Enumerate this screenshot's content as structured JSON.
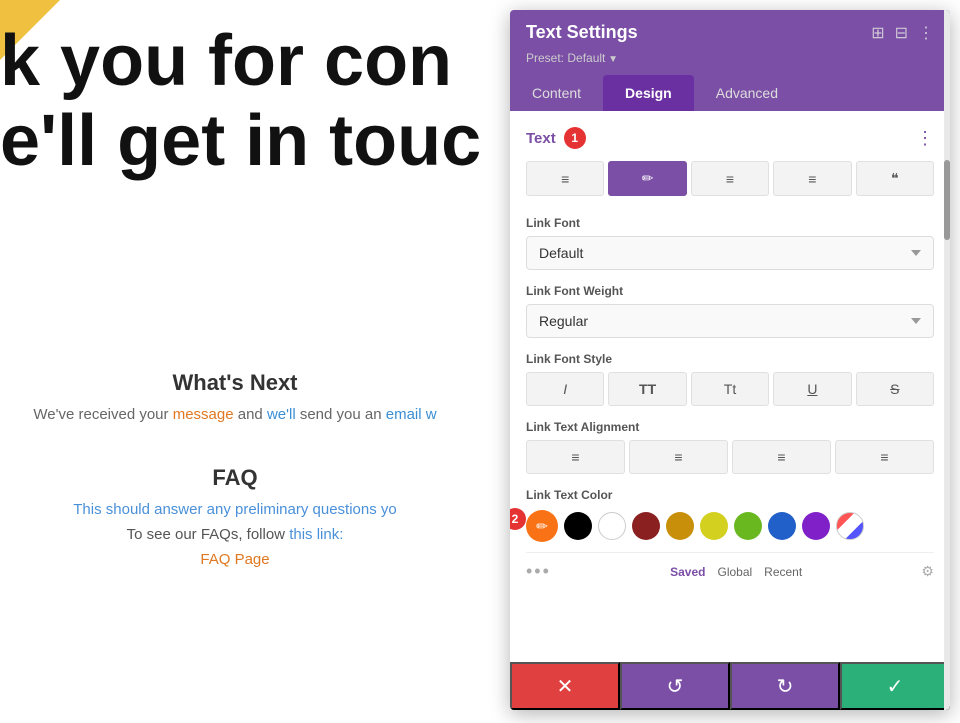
{
  "page": {
    "background_headline1": "k you for con",
    "background_headline2": "e'll get in touc",
    "whats_next_title": "What's Next",
    "whats_next_text": "We've received your message and we'll send you an email w",
    "faq_title": "FAQ",
    "faq_description": "This should answer any preliminary questions yo",
    "faq_link_text": "To see our FAQs, follow this link:",
    "faq_page_link": "FAQ Page"
  },
  "panel": {
    "title": "Text Settings",
    "preset": "Preset: Default",
    "tabs": [
      {
        "label": "Content",
        "active": false
      },
      {
        "label": "Design",
        "active": true
      },
      {
        "label": "Advanced",
        "active": false
      }
    ],
    "section_title": "Text",
    "badge1": "1",
    "badge2": "2",
    "toolbar_icons": [
      "≡",
      "✏",
      "≡",
      "≡",
      "❝"
    ],
    "link_font_label": "Link Font",
    "link_font_value": "Default",
    "link_font_weight_label": "Link Font Weight",
    "link_font_weight_value": "Regular",
    "link_font_style_label": "Link Font Style",
    "link_font_style_buttons": [
      "I",
      "TT",
      "Tt",
      "U",
      "S"
    ],
    "link_text_alignment_label": "Link Text Alignment",
    "link_text_color_label": "Link Text Color",
    "color_swatches": [
      "#000000",
      "#ffffff",
      "#8b2020",
      "#c8900a",
      "#d4d020",
      "#6ab820",
      "#2fa050",
      "#2060c8",
      "#8020c8"
    ],
    "saved_label": "Saved",
    "global_label": "Global",
    "recent_label": "Recent",
    "footer": {
      "cancel": "✕",
      "undo": "↺",
      "redo": "↻",
      "save": "✓"
    }
  }
}
